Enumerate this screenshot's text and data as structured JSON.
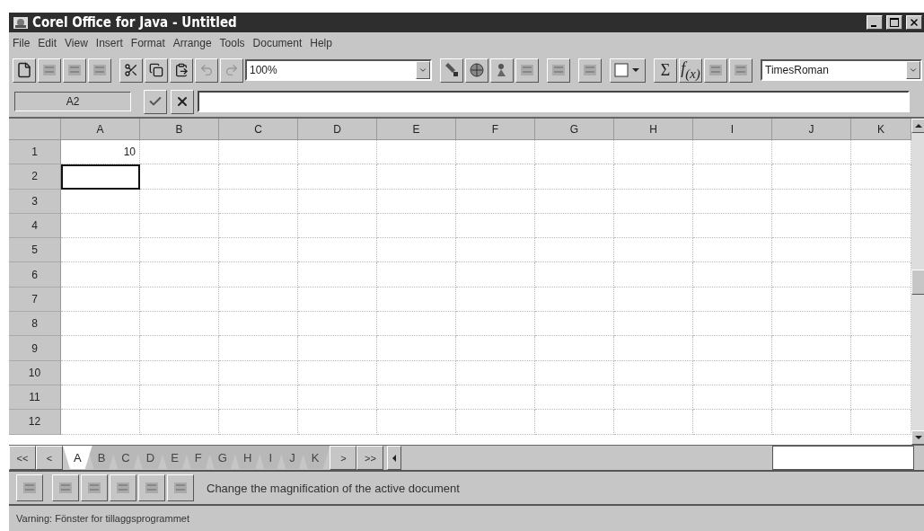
{
  "window": {
    "title": "Corel Office for Java - Untitled"
  },
  "menu": [
    "File",
    "Edit",
    "View",
    "Insert",
    "Format",
    "Arrange",
    "Tools",
    "Document",
    "Help"
  ],
  "toolbar": {
    "zoom": "100%",
    "sum_label": "Σ",
    "function_label": "f$_{(x)}$",
    "font": "TimesRoman"
  },
  "formula_bar": {
    "cell_reference": "A2"
  },
  "grid": {
    "columns": [
      "A",
      "B",
      "C",
      "D",
      "E",
      "F",
      "G",
      "H",
      "I",
      "J",
      "K"
    ],
    "rows": [
      {
        "label": "1",
        "cells": [
          {
            "text": "10",
            "selected": false
          },
          {
            "selected": false
          },
          {
            "selected": false
          },
          {
            "selected": false
          },
          {
            "selected": false
          },
          {
            "selected": false
          },
          {
            "selected": false
          },
          {
            "selected": false
          },
          {
            "selected": false
          },
          {
            "selected": false
          },
          {
            "selected": false
          }
        ]
      },
      {
        "label": "2",
        "cells": [
          {
            "selected": true
          },
          {
            "selected": false
          },
          {
            "selected": false
          },
          {
            "selected": false
          },
          {
            "selected": false
          },
          {
            "selected": false
          },
          {
            "selected": false
          },
          {
            "selected": false
          },
          {
            "selected": false
          },
          {
            "selected": false
          },
          {
            "selected": false
          }
        ]
      },
      {
        "label": "3",
        "cells": [
          {
            "selected": false
          },
          {
            "selected": false
          },
          {
            "selected": false
          },
          {
            "selected": false
          },
          {
            "selected": false
          },
          {
            "selected": false
          },
          {
            "selected": false
          },
          {
            "selected": false
          },
          {
            "selected": false
          },
          {
            "selected": false
          },
          {
            "selected": false
          }
        ]
      },
      {
        "label": "4",
        "cells": [
          {
            "selected": false
          },
          {
            "selected": false
          },
          {
            "selected": false
          },
          {
            "selected": false
          },
          {
            "selected": false
          },
          {
            "selected": false
          },
          {
            "selected": false
          },
          {
            "selected": false
          },
          {
            "selected": false
          },
          {
            "selected": false
          },
          {
            "selected": false
          }
        ]
      },
      {
        "label": "5",
        "cells": [
          {
            "selected": false
          },
          {
            "selected": false
          },
          {
            "selected": false
          },
          {
            "selected": false
          },
          {
            "selected": false
          },
          {
            "selected": false
          },
          {
            "selected": false
          },
          {
            "selected": false
          },
          {
            "selected": false
          },
          {
            "selected": false
          },
          {
            "selected": false
          }
        ]
      },
      {
        "label": "6",
        "cells": [
          {
            "selected": false
          },
          {
            "selected": false
          },
          {
            "selected": false
          },
          {
            "selected": false
          },
          {
            "selected": false
          },
          {
            "selected": false
          },
          {
            "selected": false
          },
          {
            "selected": false
          },
          {
            "selected": false
          },
          {
            "selected": false
          },
          {
            "selected": false
          }
        ]
      },
      {
        "label": "7",
        "cells": [
          {
            "selected": false
          },
          {
            "selected": false
          },
          {
            "selected": false
          },
          {
            "selected": false
          },
          {
            "selected": false
          },
          {
            "selected": false
          },
          {
            "selected": false
          },
          {
            "selected": false
          },
          {
            "selected": false
          },
          {
            "selected": false
          },
          {
            "selected": false
          }
        ]
      },
      {
        "label": "8",
        "cells": [
          {
            "selected": false
          },
          {
            "selected": false
          },
          {
            "selected": false
          },
          {
            "selected": false
          },
          {
            "selected": false
          },
          {
            "selected": false
          },
          {
            "selected": false
          },
          {
            "selected": false
          },
          {
            "selected": false
          },
          {
            "selected": false
          },
          {
            "selected": false
          }
        ]
      },
      {
        "label": "9",
        "cells": [
          {
            "selected": false
          },
          {
            "selected": false
          },
          {
            "selected": false
          },
          {
            "selected": false
          },
          {
            "selected": false
          },
          {
            "selected": false
          },
          {
            "selected": false
          },
          {
            "selected": false
          },
          {
            "selected": false
          },
          {
            "selected": false
          },
          {
            "selected": false
          }
        ]
      },
      {
        "label": "10",
        "cells": [
          {
            "selected": false
          },
          {
            "selected": false
          },
          {
            "selected": false
          },
          {
            "selected": false
          },
          {
            "selected": false
          },
          {
            "selected": false
          },
          {
            "selected": false
          },
          {
            "selected": false
          },
          {
            "selected": false
          },
          {
            "selected": false
          },
          {
            "selected": false
          }
        ]
      },
      {
        "label": "11",
        "cells": [
          {
            "selected": false
          },
          {
            "selected": false
          },
          {
            "selected": false
          },
          {
            "selected": false
          },
          {
            "selected": false
          },
          {
            "selected": false
          },
          {
            "selected": false
          },
          {
            "selected": false
          },
          {
            "selected": false
          },
          {
            "selected": false
          },
          {
            "selected": false
          }
        ]
      },
      {
        "label": "12",
        "cells": [
          {
            "selected": false
          },
          {
            "selected": false
          },
          {
            "selected": false
          },
          {
            "selected": false
          },
          {
            "selected": false
          },
          {
            "selected": false
          },
          {
            "selected": false
          },
          {
            "selected": false
          },
          {
            "selected": false
          },
          {
            "selected": false
          },
          {
            "selected": false
          }
        ]
      }
    ]
  },
  "sheet_nav": {
    "first": "<<",
    "previous": "<",
    "next": ">",
    "last": ">>"
  },
  "sheet_tabs": [
    {
      "label": "A",
      "selected": true
    },
    {
      "label": "B",
      "selected": false
    },
    {
      "label": "C",
      "selected": false
    },
    {
      "label": "D",
      "selected": false
    },
    {
      "label": "E",
      "selected": false
    },
    {
      "label": "F",
      "selected": false
    },
    {
      "label": "G",
      "selected": false
    },
    {
      "label": "H",
      "selected": false
    },
    {
      "label": "I",
      "selected": false
    },
    {
      "label": "J",
      "selected": false
    },
    {
      "label": "K",
      "selected": false
    }
  ],
  "hint": "Change the magnification of the active document",
  "status_bar": "Varning: Fönster for tillaggsprogrammet"
}
